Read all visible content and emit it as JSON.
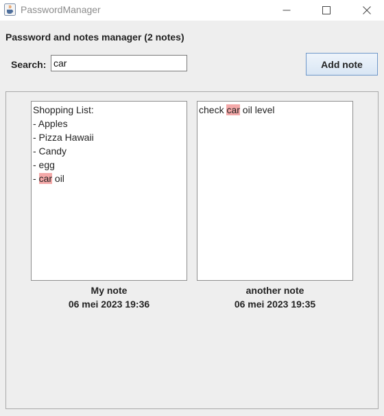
{
  "window": {
    "title": "PasswordManager",
    "icon": "java-cup-icon"
  },
  "header": {
    "title": "Password and notes manager (2 notes)"
  },
  "search": {
    "label": "Search:",
    "value": "car"
  },
  "toolbar": {
    "add_note_label": "Add note"
  },
  "highlight_color": "#f4a9a9",
  "notes": [
    {
      "lines": [
        [
          {
            "t": "Shopping List:"
          }
        ],
        [
          {
            "t": "- Apples"
          }
        ],
        [
          {
            "t": "- Pizza Hawaii"
          }
        ],
        [
          {
            "t": "- Candy"
          }
        ],
        [
          {
            "t": "- egg"
          }
        ],
        [
          {
            "t": "- "
          },
          {
            "t": "car",
            "hl": true
          },
          {
            "t": " oil"
          }
        ]
      ],
      "name": "My note",
      "date": "06 mei 2023 19:36"
    },
    {
      "lines": [
        [
          {
            "t": "check "
          },
          {
            "t": "car",
            "hl": true
          },
          {
            "t": " oil level"
          }
        ]
      ],
      "name": "another note",
      "date": "06 mei 2023 19:35"
    }
  ]
}
